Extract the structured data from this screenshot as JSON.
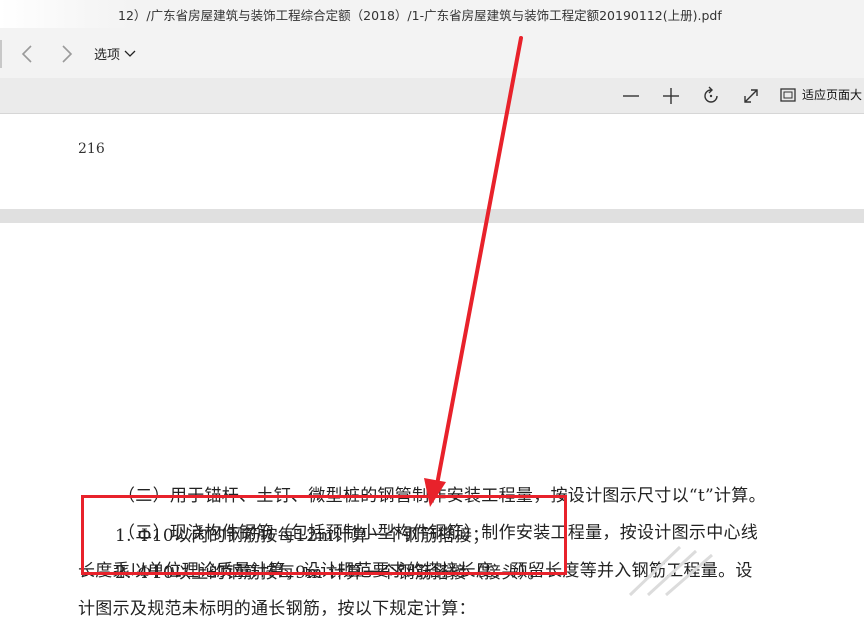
{
  "title_bar": {
    "path": "12）/广东省房屋建筑与装饰工程综合定额（2018）/1-广东省房屋建筑与装饰工程定额20190112(上册).pdf"
  },
  "nav": {
    "options_label": "选项"
  },
  "toolbar": {
    "fit_label": "适应页面大"
  },
  "page1": {
    "page_number": "216"
  },
  "page2": {
    "lines": [
      "（二）用于锚杆、土钉、微型桩的钢管制作安装工程量，按设计图示尺寸以“t”计算。",
      "（三）现浇构件钢筋（包括预制小型构件钢筋）制作安装工程量，按设计图示中心线",
      "长度乘以单位理论质量计算，设计规范要求的搭接长度、预留长度等并入钢筋工程量。设",
      "计图示及规范未标明的通长钢筋，按以下规定计算：",
      "1. Φ10以内的钢筋按每12m计算一个钢筋搭接；",
      "2. Φ10以上的钢筋按每9m 计算一个钢筋搭接（接头）。"
    ]
  },
  "colors": {
    "annotation_red": "#e8222b"
  }
}
